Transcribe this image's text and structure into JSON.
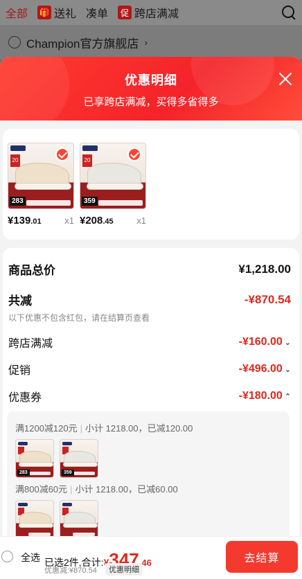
{
  "topbar": {
    "tabs": [
      {
        "label": "全部",
        "active": true
      },
      {
        "label": "送礼",
        "icon": "gift-icon"
      },
      {
        "label": "凑单"
      },
      {
        "label": "跨店满减",
        "icon_text": "促"
      }
    ]
  },
  "store": {
    "name": "Champion官方旗舰店",
    "chevron": "›"
  },
  "sheet": {
    "title": "优惠明细",
    "subtitle": "已享跨店满减，买得多省得多"
  },
  "products": [
    {
      "price_chip": "283",
      "tag": "20",
      "price_int": "¥139",
      "price_dec": ".01",
      "qty": "x1",
      "style": "a"
    },
    {
      "price_chip": "359",
      "tag": "20",
      "price_int": "¥208",
      "price_dec": ".45",
      "qty": "x1",
      "style": "b"
    }
  ],
  "summary": {
    "total_label": "商品总价",
    "total_value": "¥1,218.00",
    "reduce_label": "共减",
    "reduce_value": "-¥870.54",
    "note": "以下优惠不包含红包，请在结算页查看",
    "items": [
      {
        "label": "跨店满减",
        "value": "-¥160.00",
        "caret": "⌄"
      },
      {
        "label": "促销",
        "value": "-¥496.00",
        "caret": "⌄"
      },
      {
        "label": "优惠券",
        "value": "-¥180.00",
        "caret": "⌃"
      }
    ]
  },
  "coupons": [
    {
      "rule": "满1200减120元",
      "detail": "小计 1218.00，已减120.00"
    },
    {
      "rule": "满800减60元",
      "detail": "小计 1218.00，已减60.00"
    }
  ],
  "bottom": {
    "select_all": "全选",
    "selected_text": "已选2件,合计:",
    "currency": "¥",
    "total_int": "347",
    "total_dec": ".46",
    "discount_text": "优惠减:¥870.54",
    "detail_tag": "优惠明细",
    "checkout": "去结算"
  },
  "colors": {
    "accent": "#f43a2e",
    "discount": "#e0281c"
  }
}
